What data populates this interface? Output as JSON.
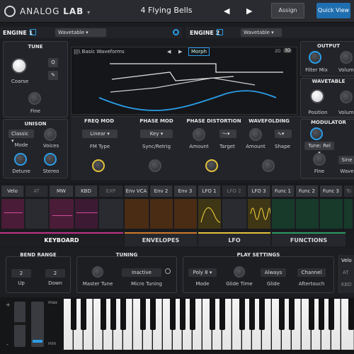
{
  "header": {
    "logo_text": "ANALOG",
    "logo_bold": "LAB",
    "logo_caret": "▾",
    "preset_name": "4 Flying Bells",
    "prev_icon": "◀",
    "next_icon": "▶",
    "assign_label": "Assign",
    "quick_view_label": "Quick View"
  },
  "engine1": {
    "label": "ENGINE 1",
    "type": "Wavetable",
    "tune_title": "TUNE",
    "coarse_label": "Coarse",
    "fine_label": "Fine",
    "q_label": "Q",
    "unison_title": "UNISON",
    "mode_value": "Classic",
    "mode_label": "Mode",
    "voices_label": "Voices",
    "detune_label": "Detune",
    "stereo_label": "Stereo"
  },
  "engine2": {
    "label": "ENGINE 2",
    "type": "Wavetable"
  },
  "display": {
    "waveform_name": "Basic Waveforms",
    "morph_label": "Morph",
    "view_2d": "2D",
    "view_3d": "3D"
  },
  "modules": {
    "freq_mod_title": "FREQ MOD",
    "freq_mod_type": "Linear",
    "fm_type_label": "FM Type",
    "phase_mod_title": "PHASE MOD",
    "phase_mod_value": "Key",
    "sync_label": "Sync/Retrig",
    "phase_dist_title": "PHASE DISTORTION",
    "amount_label": "Amount",
    "target_label": "Target",
    "wavefolding_title": "WAVEFOLDING",
    "wf_amount_label": "Amount",
    "shape_label": "Shape"
  },
  "output": {
    "title": "OUTPUT",
    "filter_mix_label": "Filter Mix",
    "volume_label": "Volume",
    "wavetable_title": "WAVETABLE",
    "position_label": "Position",
    "wt_volume_label": "Volume",
    "modulator_title": "MODULATOR",
    "tune_rel_label": "Tune: Rel",
    "mod_fine_label": "Fine",
    "wave_label": "Wave",
    "wave_value": "Sine"
  },
  "mod_tabs": [
    "Velo",
    "AT",
    "MW",
    "KBD",
    "EXP",
    "Env VCA",
    "Env 2",
    "Env 3",
    "LFO 1",
    "LFO 2",
    "LFO 3",
    "Func 1",
    "Func 2",
    "Func 3",
    "To"
  ],
  "bottom_tabs": {
    "keyboard": "KEYBOARD",
    "envelopes": "ENVELOPES",
    "lfo": "LFO",
    "functions": "FUNCTIONS"
  },
  "keyboard_panel": {
    "bend_title": "BEND RANGE",
    "up_value": "2",
    "up_label": "Up",
    "down_value": "2",
    "down_label": "Down",
    "tuning_title": "TUNING",
    "master_tune_label": "Master Tune",
    "micro_value": "Inactive",
    "micro_label": "Micro Tuning",
    "play_title": "PLAY SETTINGS",
    "mode_value": "Poly 8",
    "mode_label": "Mode",
    "glide_time_label": "Glide Time",
    "glide_value": "Always",
    "glide_label": "Glide",
    "aftertouch_value": "Channel",
    "aftertouch_label": "Aftertouch",
    "side_items": [
      "Velo",
      "AT",
      "KBD"
    ]
  },
  "piano": {
    "plus": "+",
    "minus": "-",
    "max_label": "max",
    "min_label": "min"
  },
  "colors": {
    "accent_blue": "#2a9ee8",
    "magenta": "#c0328a",
    "orange": "#d07a2a",
    "yellow": "#e2c23a",
    "green": "#2a9a62"
  }
}
